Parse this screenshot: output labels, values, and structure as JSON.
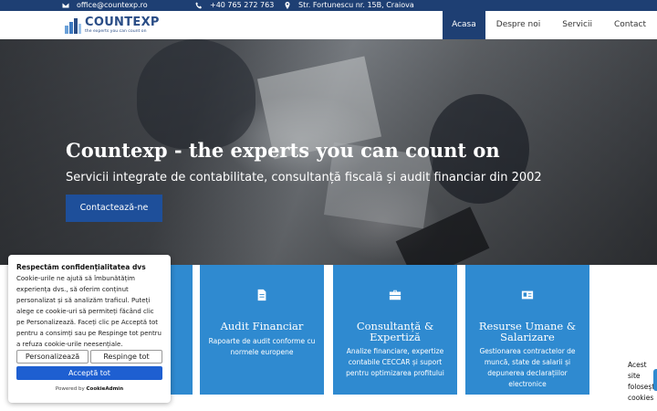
{
  "topbar": {
    "email": "office@countexp.ro",
    "phone": "+40 765 272 763",
    "address": "Str. Fortunescu nr. 15B, Craiova",
    "icons": [
      "envelope-icon",
      "phone-icon",
      "map-marker-icon"
    ]
  },
  "header": {
    "logo_name": "COUNTEXP",
    "logo_tagline": "the experts you can count on",
    "nav": [
      "Acasa",
      "Despre noi",
      "Servicii",
      "Contact"
    ],
    "active_nav": "Acasa"
  },
  "hero": {
    "title": "Countexp - the experts you can count on",
    "subtitle": "Servicii integrate de contabilitate, consultanță fiscală și audit financiar din 2002",
    "cta": "Contactează-ne"
  },
  "services": [
    {
      "title": "Audit Financiar",
      "text": "Rapoarte de audit conforme cu normele europene",
      "icon": "document-icon"
    },
    {
      "title": "Consultanță & Expertiză",
      "text": "Analize financiare, expertize contabile CECCAR și suport pentru optimizarea profitului",
      "icon": "briefcase-icon"
    },
    {
      "title": "Resurse Umane & Salarizare",
      "text": "Gestionarea contractelor de muncă, state de salarii și depunerea declarațiilor electronice",
      "icon": "id-card-icon"
    }
  ],
  "cookie": {
    "title": "Respectăm confidențialitatea dvs",
    "text": "Cookie-urile ne ajută să îmbunătățim experiența dvs., să oferim conținut personalizat și să analizăm traficul. Puteți alege ce cookie-uri să permiteți făcând clic pe Personalizează. Faceți clic pe Acceptă tot pentru a consimți sau pe Respinge tot pentru a refuza cookie-urile neesențiale.",
    "customize": "Personalizează",
    "reject": "Respinge tot",
    "accept": "Acceptă tot",
    "powered_prefix": "Powered by",
    "powered_brand": "CookieAdmin"
  },
  "side_widget": {
    "line1": "Acest",
    "line2": "site",
    "line3": "folosește",
    "line4": "cookies"
  },
  "colors": {
    "primary_dark": "#1e3f73",
    "card_blue": "#2f8ad0",
    "button_blue": "#1e4f9a",
    "accept_blue": "#1e5fd1"
  }
}
